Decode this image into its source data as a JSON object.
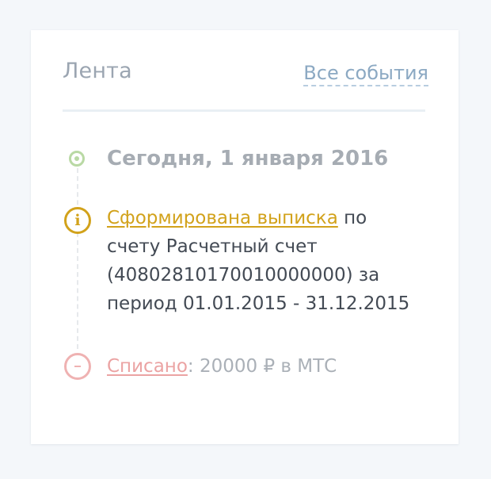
{
  "feed": {
    "title": "Лента",
    "all_events_link": "Все события"
  },
  "timeline": {
    "date_heading": "Сегодня, 1 января 2016",
    "events": [
      {
        "type": "info",
        "icon": "info-icon",
        "link_text": "Сформирована выписка",
        "text_line1_rest": " по",
        "text_line2": "счету Расчетный счет",
        "text_line3": "(40802810170010000000) за",
        "text_line4": "период 01.01.2015 - 31.12.2015"
      },
      {
        "type": "debit",
        "icon": "minus-icon",
        "link_text": "Списано",
        "details": ": 20000 ₽ в МТС"
      }
    ]
  },
  "colors": {
    "background": "#f4f7fa",
    "card": "#ffffff",
    "title_gray": "#9ba5b1",
    "link_blue": "#8ca9c3",
    "today_green": "#b9d9a4",
    "info_gold": "#d2a21b",
    "debit_pink": "#efb2b2",
    "body_text": "#434a54"
  }
}
